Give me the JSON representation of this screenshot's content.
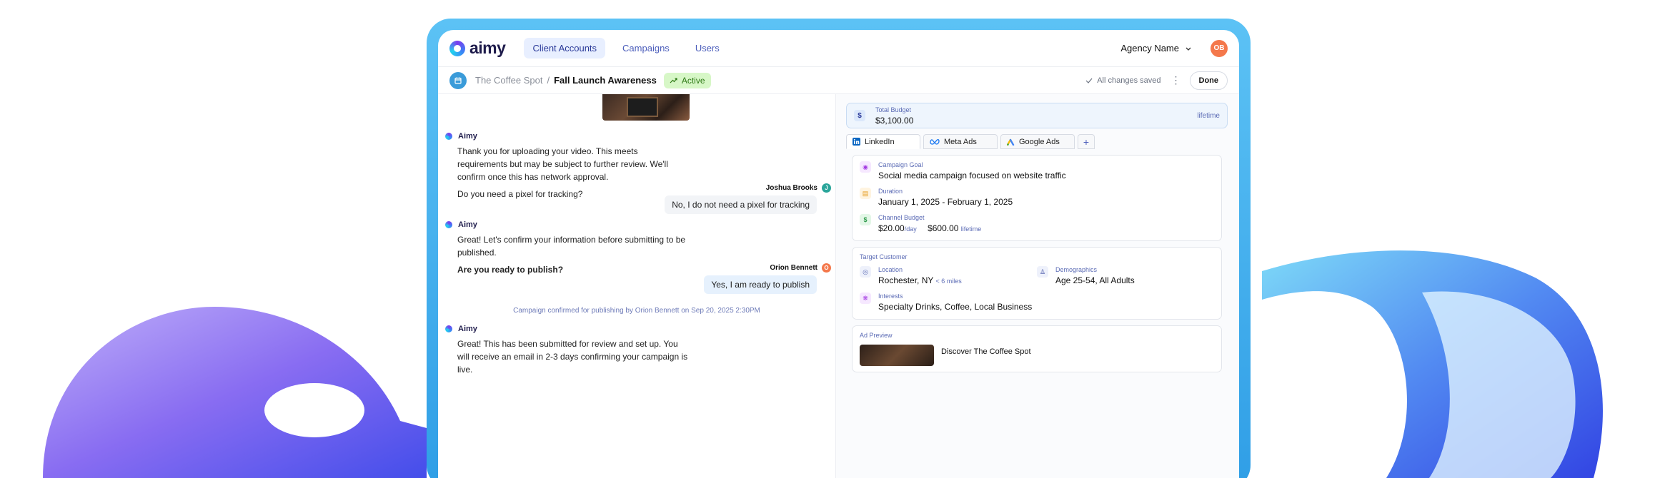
{
  "colors": {
    "accent": "#2b3a9a",
    "frame": "#3aa6ea",
    "active_pill_bg": "#d7f7c7",
    "active_pill_text": "#2f7a16",
    "avatar_ob": "#f4784b",
    "avatar_j": "#2aa59a",
    "avatar_o": "#f4784b"
  },
  "nav": {
    "logo": "aimy",
    "tabs": [
      {
        "label": "Client Accounts",
        "active": true
      },
      {
        "label": "Campaigns",
        "active": false
      },
      {
        "label": "Users",
        "active": false
      }
    ],
    "agency": "Agency Name",
    "avatar_initials": "OB"
  },
  "subbar": {
    "client": "The Coffee Spot",
    "separator": "/",
    "campaign": "Fall Launch Awareness",
    "status": "Active",
    "saved": "All changes saved",
    "done": "Done"
  },
  "chat": {
    "m1": {
      "sender": "Aimy",
      "line1": "Thank you for uploading your video. This meets requirements but may be subject to further review. We'll confirm once this has network approval.",
      "line2": "Do you need a pixel for tracking?"
    },
    "u1": {
      "name": "Joshua Brooks",
      "initial": "J",
      "text": "No, I do not need a pixel for tracking"
    },
    "m2": {
      "sender": "Aimy",
      "line1": "Great! Let's confirm your information before submitting to be published.",
      "line2": "Are you ready to publish?"
    },
    "u2": {
      "name": "Orion Bennett",
      "initial": "O",
      "text": "Yes, I am ready to publish"
    },
    "system": "Campaign confirmed for publishing by Orion Bennett on Sep 20, 2025 2:30PM",
    "m3": {
      "sender": "Aimy",
      "line1": "Great! This has been submitted for review and set up. You will receive an email in 2-3 days confirming your campaign is live."
    }
  },
  "panel": {
    "budget": {
      "label": "Total Budget",
      "value": "$3,100.00",
      "period": "lifetime"
    },
    "tabs": [
      {
        "label": "LinkedIn",
        "icon": "linkedin-icon",
        "active": true
      },
      {
        "label": "Meta Ads",
        "icon": "meta-icon",
        "active": false
      },
      {
        "label": "Google Ads",
        "icon": "google-ads-icon",
        "active": false
      }
    ],
    "add_tab": "+",
    "goal": {
      "label": "Campaign Goal",
      "value": "Social media campaign focused on website traffic"
    },
    "duration": {
      "label": "Duration",
      "value": "January 1, 2025 - February 1, 2025"
    },
    "channel_budget": {
      "label": "Channel Budget",
      "daily": "$20.00",
      "daily_unit": "/day",
      "lifetime": "$600.00",
      "lifetime_unit": "lifetime"
    },
    "target": {
      "title": "Target Customer",
      "location_label": "Location",
      "location_value": "Rochester, NY",
      "location_radius": "< 6 miles",
      "demo_label": "Demographics",
      "demo_value": "Age 25-54, All Adults",
      "interests_label": "Interests",
      "interests_value": "Specialty Drinks, Coffee, Local Business"
    },
    "ad_preview": {
      "title": "Ad Preview",
      "headline": "Discover The Coffee Spot"
    }
  }
}
